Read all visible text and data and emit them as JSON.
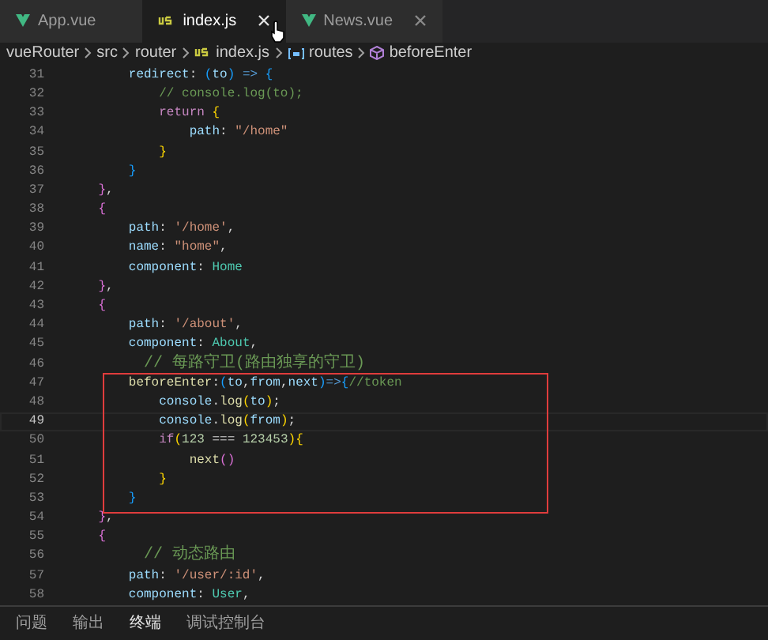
{
  "tabs": [
    {
      "label": "App.vue",
      "kind": "vue",
      "selected": false,
      "close": false
    },
    {
      "label": "index.js",
      "kind": "js",
      "selected": true,
      "close": true
    },
    {
      "label": "News.vue",
      "kind": "vue",
      "selected": false,
      "close": true
    }
  ],
  "breadcrumbs": [
    {
      "label": "vueRouter",
      "kind": "folder"
    },
    {
      "label": "src",
      "kind": "folder"
    },
    {
      "label": "router",
      "kind": "folder"
    },
    {
      "label": "index.js",
      "kind": "js"
    },
    {
      "label": "routes",
      "kind": "variable"
    },
    {
      "label": "beforeEnter",
      "kind": "method"
    }
  ],
  "editor": {
    "annotation": {
      "color": "#e03c3c"
    },
    "lines": [
      {
        "number": "31",
        "current": false,
        "boxed": false,
        "tokens": [
          {
            "kind": "prop",
            "text": "        redirect"
          },
          {
            "kind": "punct",
            "text": ": "
          },
          {
            "kind": "b3",
            "text": "("
          },
          {
            "kind": "param",
            "text": "to"
          },
          {
            "kind": "b3",
            "text": ")"
          },
          {
            "kind": "op",
            "text": " => "
          },
          {
            "kind": "b3",
            "text": "{"
          }
        ]
      },
      {
        "number": "32",
        "current": false,
        "boxed": false,
        "tokens": [
          {
            "kind": "comment",
            "text": "            // console.log(to);"
          }
        ]
      },
      {
        "number": "33",
        "current": false,
        "boxed": false,
        "tokens": [
          {
            "kind": "keyword",
            "text": "            return "
          },
          {
            "kind": "b1",
            "text": "{"
          }
        ]
      },
      {
        "number": "34",
        "current": false,
        "boxed": false,
        "tokens": [
          {
            "kind": "prop",
            "text": "                path"
          },
          {
            "kind": "punct",
            "text": ": "
          },
          {
            "kind": "string",
            "text": "\"/home\""
          }
        ]
      },
      {
        "number": "35",
        "current": false,
        "boxed": false,
        "tokens": [
          {
            "kind": "b1",
            "text": "            }"
          }
        ]
      },
      {
        "number": "36",
        "current": false,
        "boxed": false,
        "tokens": [
          {
            "kind": "b3",
            "text": "        }"
          }
        ]
      },
      {
        "number": "37",
        "current": false,
        "boxed": false,
        "tokens": [
          {
            "kind": "b2",
            "text": "    }"
          },
          {
            "kind": "punct",
            "text": ","
          }
        ]
      },
      {
        "number": "38",
        "current": false,
        "boxed": false,
        "tokens": [
          {
            "kind": "b2",
            "text": "    {"
          }
        ]
      },
      {
        "number": "39",
        "current": false,
        "boxed": false,
        "tokens": [
          {
            "kind": "prop",
            "text": "        path"
          },
          {
            "kind": "punct",
            "text": ": "
          },
          {
            "kind": "string",
            "text": "'/home'"
          },
          {
            "kind": "punct",
            "text": ","
          }
        ]
      },
      {
        "number": "40",
        "current": false,
        "boxed": false,
        "tokens": [
          {
            "kind": "prop",
            "text": "        name"
          },
          {
            "kind": "punct",
            "text": ": "
          },
          {
            "kind": "string",
            "text": "\"home\""
          },
          {
            "kind": "punct",
            "text": ","
          }
        ]
      },
      {
        "number": "41",
        "current": false,
        "boxed": false,
        "tokens": [
          {
            "kind": "prop",
            "text": "        component"
          },
          {
            "kind": "punct",
            "text": ": "
          },
          {
            "kind": "cls",
            "text": "Home"
          }
        ]
      },
      {
        "number": "42",
        "current": false,
        "boxed": false,
        "tokens": [
          {
            "kind": "b2",
            "text": "    }"
          },
          {
            "kind": "punct",
            "text": ","
          }
        ]
      },
      {
        "number": "43",
        "current": false,
        "boxed": false,
        "tokens": [
          {
            "kind": "b2",
            "text": "    {"
          }
        ]
      },
      {
        "number": "44",
        "current": false,
        "boxed": false,
        "tokens": [
          {
            "kind": "prop",
            "text": "        path"
          },
          {
            "kind": "punct",
            "text": ": "
          },
          {
            "kind": "string",
            "text": "'/about'"
          },
          {
            "kind": "punct",
            "text": ","
          }
        ]
      },
      {
        "number": "45",
        "current": false,
        "boxed": false,
        "tokens": [
          {
            "kind": "prop",
            "text": "        component"
          },
          {
            "kind": "punct",
            "text": ": "
          },
          {
            "kind": "cls",
            "text": "About"
          },
          {
            "kind": "punct",
            "text": ","
          }
        ]
      },
      {
        "number": "46",
        "current": false,
        "boxed": false,
        "tokens": [
          {
            "kind": "comment",
            "text": "        // 每路守卫(路由独享的守卫)"
          }
        ]
      },
      {
        "number": "47",
        "current": false,
        "boxed": true,
        "tokens": [
          {
            "kind": "func",
            "text": "        beforeEnter"
          },
          {
            "kind": "punct",
            "text": ":"
          },
          {
            "kind": "b3",
            "text": "("
          },
          {
            "kind": "param",
            "text": "to"
          },
          {
            "kind": "punct",
            "text": ","
          },
          {
            "kind": "param",
            "text": "from"
          },
          {
            "kind": "punct",
            "text": ","
          },
          {
            "kind": "param",
            "text": "next"
          },
          {
            "kind": "b3",
            "text": ")"
          },
          {
            "kind": "op",
            "text": "=>"
          },
          {
            "kind": "b3",
            "text": "{"
          },
          {
            "kind": "comment",
            "text": "//token"
          }
        ]
      },
      {
        "number": "48",
        "current": false,
        "boxed": true,
        "tokens": [
          {
            "kind": "param",
            "text": "            console"
          },
          {
            "kind": "punct",
            "text": "."
          },
          {
            "kind": "func",
            "text": "log"
          },
          {
            "kind": "b1",
            "text": "("
          },
          {
            "kind": "param",
            "text": "to"
          },
          {
            "kind": "b1",
            "text": ")"
          },
          {
            "kind": "punct",
            "text": ";"
          }
        ]
      },
      {
        "number": "49",
        "current": true,
        "boxed": true,
        "tokens": [
          {
            "kind": "param",
            "text": "            console"
          },
          {
            "kind": "punct",
            "text": "."
          },
          {
            "kind": "func",
            "text": "log"
          },
          {
            "kind": "b1",
            "text": "("
          },
          {
            "kind": "param",
            "text": "from"
          },
          {
            "kind": "b1",
            "text": ")"
          },
          {
            "kind": "punct",
            "text": ";"
          }
        ]
      },
      {
        "number": "50",
        "current": false,
        "boxed": true,
        "tokens": [
          {
            "kind": "keyword",
            "text": "            if"
          },
          {
            "kind": "b1",
            "text": "("
          },
          {
            "kind": "number",
            "text": "123"
          },
          {
            "kind": "punct",
            "text": " === "
          },
          {
            "kind": "number",
            "text": "123453"
          },
          {
            "kind": "b1",
            "text": ")"
          },
          {
            "kind": "b1",
            "text": "{"
          }
        ]
      },
      {
        "number": "51",
        "current": false,
        "boxed": true,
        "tokens": [
          {
            "kind": "func",
            "text": "                next"
          },
          {
            "kind": "b2",
            "text": "()"
          }
        ]
      },
      {
        "number": "52",
        "current": false,
        "boxed": true,
        "tokens": [
          {
            "kind": "b1",
            "text": "            }"
          }
        ]
      },
      {
        "number": "53",
        "current": false,
        "boxed": true,
        "tokens": [
          {
            "kind": "b3",
            "text": "        }"
          }
        ]
      },
      {
        "number": "54",
        "current": false,
        "boxed": false,
        "tokens": [
          {
            "kind": "b2",
            "text": "    }"
          },
          {
            "kind": "punct",
            "text": ","
          }
        ]
      },
      {
        "number": "55",
        "current": false,
        "boxed": false,
        "tokens": [
          {
            "kind": "b2",
            "text": "    {"
          }
        ]
      },
      {
        "number": "56",
        "current": false,
        "boxed": false,
        "tokens": [
          {
            "kind": "comment",
            "text": "        // 动态路由"
          }
        ]
      },
      {
        "number": "57",
        "current": false,
        "boxed": false,
        "tokens": [
          {
            "kind": "prop",
            "text": "        path"
          },
          {
            "kind": "punct",
            "text": ": "
          },
          {
            "kind": "string",
            "text": "'/user/:id'"
          },
          {
            "kind": "punct",
            "text": ","
          }
        ]
      },
      {
        "number": "58",
        "current": false,
        "boxed": false,
        "tokens": [
          {
            "kind": "prop",
            "text": "        component"
          },
          {
            "kind": "punct",
            "text": ": "
          },
          {
            "kind": "cls",
            "text": "User"
          },
          {
            "kind": "punct",
            "text": ","
          }
        ]
      }
    ]
  },
  "panel_tabs": [
    {
      "label": "问题",
      "selected": false
    },
    {
      "label": "输出",
      "selected": false
    },
    {
      "label": "终端",
      "selected": true
    },
    {
      "label": "调试控制台",
      "selected": false
    }
  ]
}
